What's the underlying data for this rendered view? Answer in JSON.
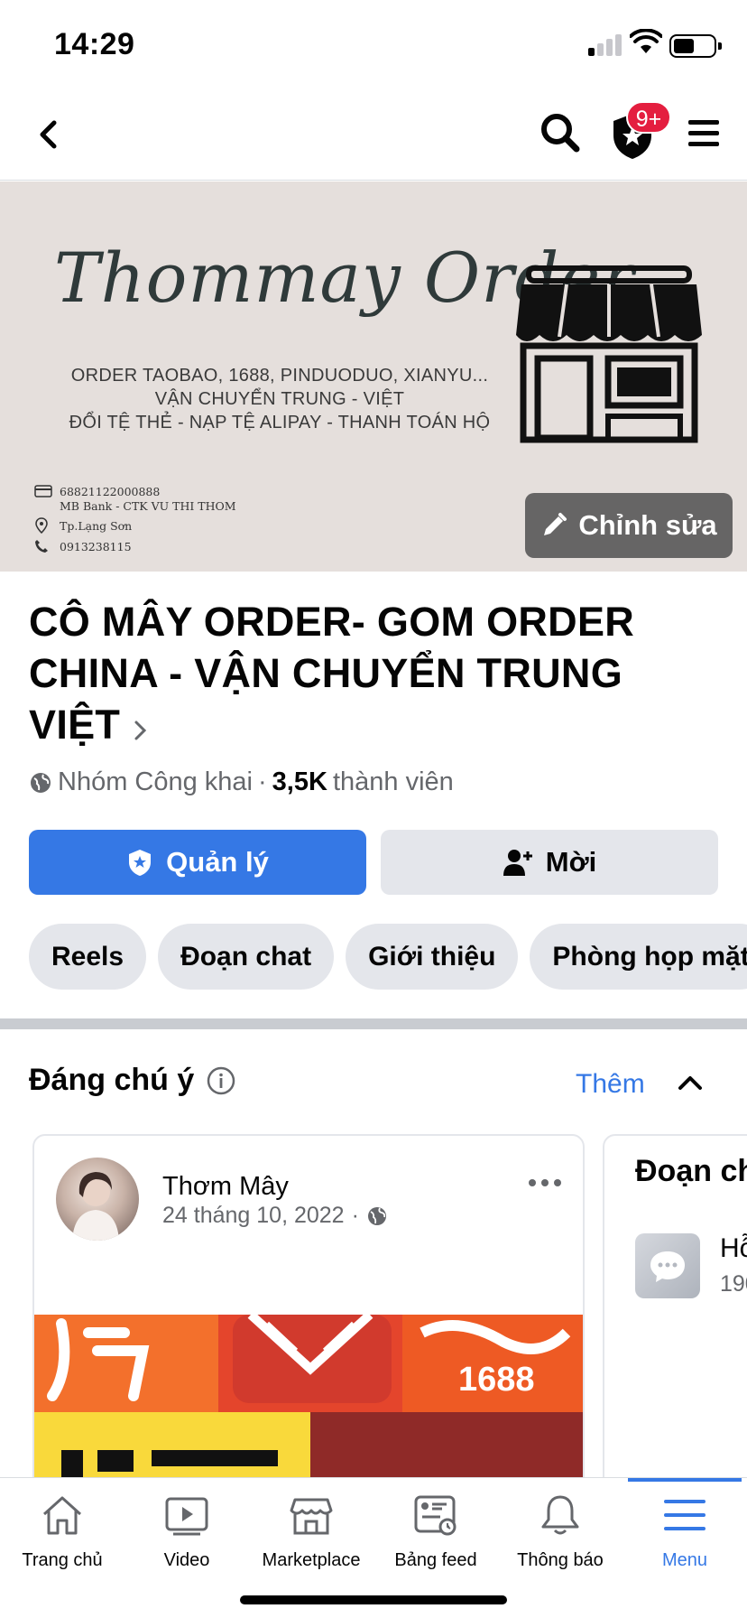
{
  "status": {
    "time": "14:29"
  },
  "nav": {
    "badge": "9+"
  },
  "cover": {
    "title": "Thommay Order",
    "lines": [
      "ORDER TAOBAO, 1688, PINDUODUO, XIANYU...",
      "VẬN CHUYỂN TRUNG - VIỆT",
      "ĐỔI TỆ THẺ - NẠP TỆ ALIPAY - THANH TOÁN HỘ"
    ],
    "account_number": "68821122000888",
    "bank": "MB Bank - CTK VU THI THOM",
    "location": "Tp.Lạng Sơn",
    "phone": "0913238115",
    "edit_label": "Chỉnh sửa"
  },
  "group": {
    "name": "CÔ MÂY ORDER- GOM ORDER CHINA - VẬN CHUYỂN TRUNG VIỆT",
    "privacy": "Nhóm Công khai",
    "separator": "·",
    "member_count": "3,5K",
    "member_label": "thành viên",
    "manage_label": "Quản lý",
    "invite_label": "Mời",
    "chips": [
      "Reels",
      "Đoạn chat",
      "Giới thiệu",
      "Phòng họp mặt"
    ]
  },
  "featured": {
    "title": "Đáng chú ý",
    "more_label": "Thêm",
    "post": {
      "author": "Thơm Mây",
      "date": "24 tháng 10, 2022",
      "dot": "·",
      "image_text": "1688"
    },
    "chat_card": {
      "title": "Đoạn ch",
      "item_name": "Hỗ",
      "item_sub": "190"
    }
  },
  "tabs": [
    {
      "label": "Trang chủ",
      "icon": "home-icon"
    },
    {
      "label": "Video",
      "icon": "video-icon"
    },
    {
      "label": "Marketplace",
      "icon": "marketplace-icon"
    },
    {
      "label": "Bảng feed",
      "icon": "feed-icon"
    },
    {
      "label": "Thông báo",
      "icon": "bell-icon"
    },
    {
      "label": "Menu",
      "icon": "menu-icon"
    }
  ],
  "colors": {
    "accent": "#3578e5",
    "badge": "#e41e3f",
    "chip": "#e4e6eb",
    "secondary_text": "#65676b"
  }
}
